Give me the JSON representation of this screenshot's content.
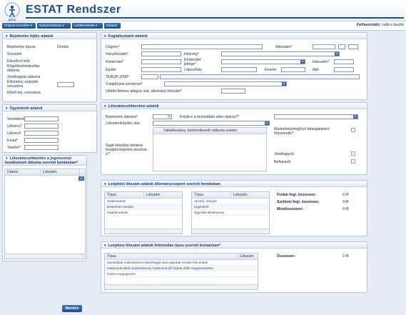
{
  "app": {
    "title": "ESTAT Rendszer",
    "logo_caption": "ÁFSZ"
  },
  "menu": {
    "items": [
      "Űrlapok kezelése ▾",
      "Nyilvántartások ▾",
      "Letöltendések ▾",
      "Kilépés"
    ],
    "user_label": "Felhasználó:",
    "user_name": "radics.laszlo"
  },
  "bejelentes": {
    "title": "Bejelentés fejléc adatok",
    "fields": [
      {
        "label": "Bejelentés típusa",
        "value": "Döntés"
      },
      {
        "label": "Sorszám",
        "value": ""
      },
      {
        "label": "Ellenőrző kód",
        "value": ""
      },
      {
        "label": "Rögzítés/módosítás dátuma",
        "value": ""
      },
      {
        "label": "Jóváhagyás dátuma",
        "value": ""
      },
      {
        "label": "Előzmény szándék sorszáma",
        "value": ""
      },
      {
        "label": "Előző bej. sorszáma",
        "value": ""
      }
    ]
  },
  "ugyintezo": {
    "title": "Ügyintézői adatok",
    "fields": [
      "Vezetéknév",
      "Utónév1",
      "Utónév2",
      "Email",
      "Telefon"
    ]
  },
  "letszam_jogviszony": {
    "title": "Létszámcsökkentés a jogviszonyt kezdésének dátuma szerinti bontásban",
    "col_date": "Dátum",
    "col_count": "Létszám"
  },
  "foglalkoztato": {
    "title": "Foglalkoztatói adatok",
    "cegnev": "Cégnév",
    "adoszam": "Adószám",
    "iranyitoszam": "Irányítószám",
    "helyseg": "Helység",
    "kozterulet": "Közterület",
    "kozterulet_jelleg": "Közterület jellege",
    "hazszam": "Házszám",
    "epulet": "Épület",
    "lepcsohaz": "Lépcsőház",
    "emelet": "Emelet",
    "ajto": "Ajtó",
    "teaor": "TEAOR 2008",
    "tulajdonosi": "Tulajdonosi szerkezet",
    "utobbi": "Utóbbi féléves átlagos stat. állományi létszám"
  },
  "letszamcsokkentes": {
    "title": "Létszámcsökkentési adatok",
    "bejelentes_datuma": "Bejelentés dátuma",
    "folyik": "Folyik-e a munkáltató ellen eljárás?",
    "oka": "Létszámleépítés oka",
    "munkahelymegorzo": "Munkahelymegőrző támogatásért folyamodik?",
    "valtozas_header": "Vállalkozásra, bekövetkezett változás esetén",
    "sajat": "Saját leépítési döntése további leépítést okozhat-e?",
    "jovahagyott": "Jóváhagyott",
    "befejezett": "Befejezett"
  },
  "allomanycsoport": {
    "title": "Leépítési létszám adatok állománycsoport szerinti bontásban",
    "col_tipus": "Típus",
    "col_letszam": "Létszám",
    "fizikai_rows": [
      "Szakmunkás",
      "Betanított munkás",
      "Segédmunkás"
    ],
    "szellemi_rows": [
      "Vezető, irányító",
      "Ügyintéző",
      "Ügyviteli alkalmazott"
    ],
    "totals": [
      {
        "label": "Fizikai fogl. összesen:",
        "value": "0 fő"
      },
      {
        "label": "Szellemi fogl. összesen:",
        "value": "0 fő"
      },
      {
        "label": "Mindösszesen:",
        "value": "0 fő"
      }
    ]
  },
  "felmondas": {
    "title": "Leépítési létszám adatok felmondás típus szerinti bontásban",
    "col_tipus": "Típus",
    "col_letszam": "Létszám",
    "rows": [
      "Munkáltató működésével összefüggő okra alapított rendes felmondás",
      "Határozott idejű munkaviszony határozott idő lejárta előtti megszüntetése",
      "Közös megegyezés"
    ],
    "total_label": "Összesen:",
    "total_value": "0 fő"
  },
  "buttons": {
    "save": "Mentés"
  }
}
